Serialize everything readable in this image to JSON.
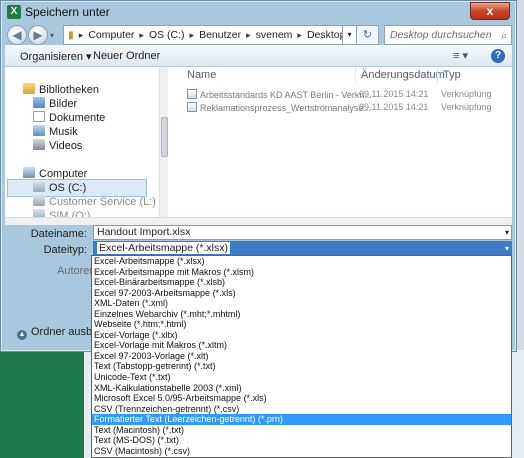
{
  "window": {
    "title": "Speichern unter",
    "app_icon": "X",
    "close_label": "x"
  },
  "nav": {
    "back_icon": "◀",
    "forward_icon": "▶",
    "breadcrumb": [
      "Computer",
      "OS (C:)",
      "Benutzer",
      "svenem",
      "Desktop"
    ],
    "search_placeholder": "Desktop durchsuchen"
  },
  "toolbar": {
    "organize_label": "Organisieren ▾",
    "new_folder_label": "Neuer Ordner",
    "view_icon": "≡ ▾",
    "help_icon": "?"
  },
  "sidebar": {
    "libraries_label": "Bibliotheken",
    "library_items": [
      "Bilder",
      "Dokumente",
      "Musik",
      "Videos"
    ],
    "computer_label": "Computer",
    "drives": [
      "OS (C:)",
      "Customer Service (L:)",
      "SIM (O:)"
    ]
  },
  "files": {
    "columns": [
      "Name",
      "Änderungsdatum",
      "Typ"
    ],
    "rows": [
      {
        "name": "Arbeitsstandards KD AAST Berlin - Verkn...",
        "date": "09.11.2015 14:21",
        "type": "Verknüpfung"
      },
      {
        "name": "Reklamationsprozess_Wertstromanalyse...",
        "date": "09.11.2015 14:21",
        "type": "Verknüpfung"
      }
    ]
  },
  "form": {
    "filename_label": "Dateiname:",
    "filename_value": "Handout Import.xlsx",
    "filetype_label": "Dateityp:",
    "filetype_value": "Excel-Arbeitsmappe (*.xlsx)",
    "authors_label": "Autoren:",
    "hide_folders_label": "Ordner ausblende"
  },
  "filetype_options": [
    "Excel-Arbeitsmappe (*.xlsx)",
    "Excel-Arbeitsmappe mit Makros (*.xlsm)",
    "Excel-Binärarbeitsmappe (*.xlsb)",
    "Excel 97-2003-Arbeitsmappe (*.xls)",
    "XML-Daten (*.xml)",
    "Einzelnes Webarchiv (*.mht;*.mhtml)",
    "Webseite (*.htm;*.html)",
    "Excel-Vorlage (*.xltx)",
    "Excel-Vorlage mit Makros (*.xltm)",
    "Excel 97-2003-Vorlage (*.xlt)",
    "Text (Tabstopp-getrennt) (*.txt)",
    "Unicode-Text (*.txt)",
    "XML-Kalkulationstabelle 2003 (*.xml)",
    "Microsoft Excel 5.0/95-Arbeitsmappe (*.xls)",
    "CSV (Trennzeichen-getrennt) (*.csv)",
    "Formatierter Text (Leerzeichen-getrennt) (*.prn)",
    "Text (Macintosh) (*.txt)",
    "Text (MS-DOS) (*.txt)",
    "CSV (Macintosh) (*.csv)",
    "CSV (MS-DOS) (*.csv)"
  ],
  "selected_option": "Formatierter Text (Leerzeichen-getrennt) (*.prn)"
}
